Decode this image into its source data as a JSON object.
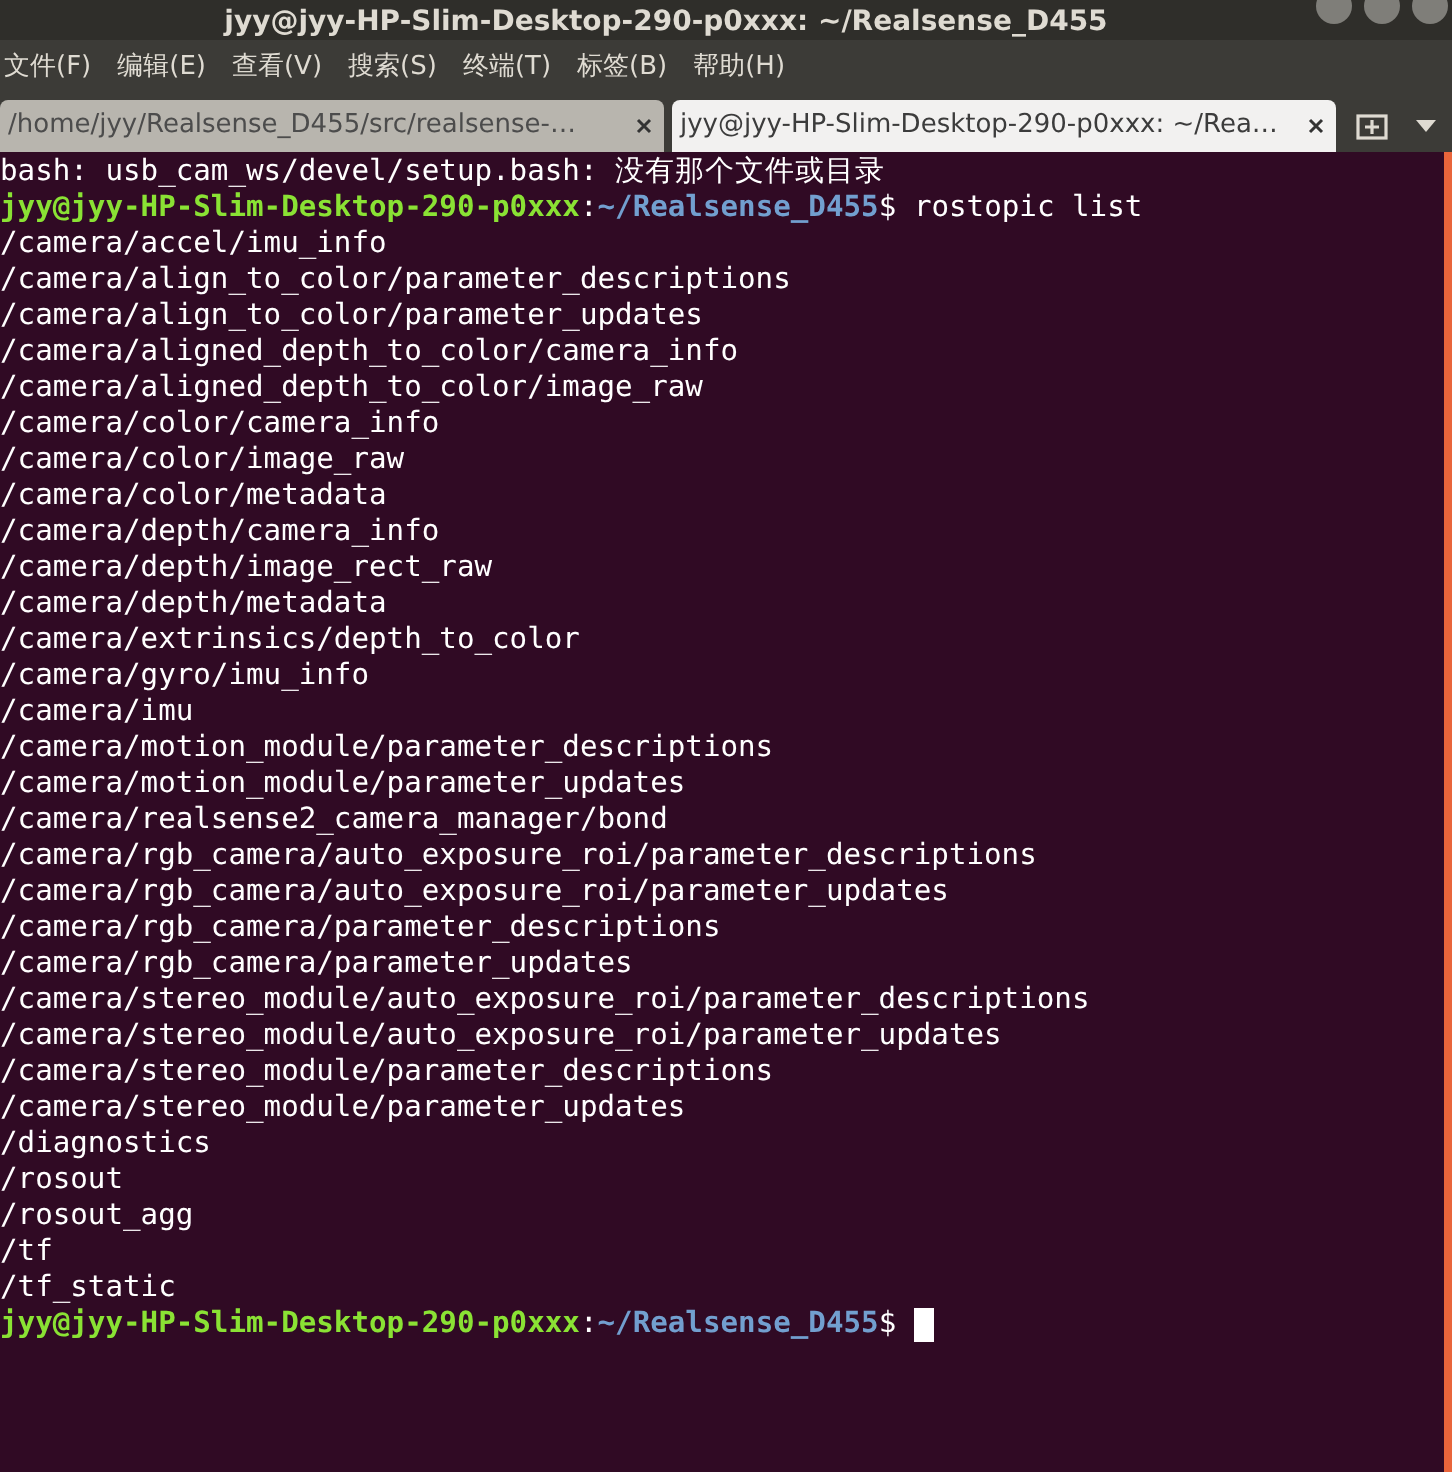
{
  "window": {
    "title": "jyy@jyy-HP-Slim-Desktop-290-p0xxx: ~/Realsense_D455"
  },
  "menu": [
    "文件(F)",
    "编辑(E)",
    "查看(V)",
    "搜索(S)",
    "终端(T)",
    "标签(B)",
    "帮助(H)"
  ],
  "tabs": [
    {
      "label": "/home/jyy/Realsense_D455/src/realsense-…",
      "selected": false
    },
    {
      "label": "jyy@jyy-HP-Slim-Desktop-290-p0xxx: ~/Rea…",
      "selected": true
    }
  ],
  "lines": [
    {
      "kind": "output",
      "text": "bash: usb_cam_ws/devel/setup.bash: 没有那个文件或目录"
    },
    {
      "kind": "prompt",
      "user": "jyy@jyy-HP-Slim-Desktop-290-p0xxx",
      "sep": ":",
      "path": "~/Realsense_D455",
      "sign": "$",
      "command": "rostopic list",
      "cursor": false
    },
    {
      "kind": "output",
      "text": "/camera/accel/imu_info"
    },
    {
      "kind": "output",
      "text": "/camera/align_to_color/parameter_descriptions"
    },
    {
      "kind": "output",
      "text": "/camera/align_to_color/parameter_updates"
    },
    {
      "kind": "output",
      "text": "/camera/aligned_depth_to_color/camera_info"
    },
    {
      "kind": "output",
      "text": "/camera/aligned_depth_to_color/image_raw"
    },
    {
      "kind": "output",
      "text": "/camera/color/camera_info"
    },
    {
      "kind": "output",
      "text": "/camera/color/image_raw"
    },
    {
      "kind": "output",
      "text": "/camera/color/metadata"
    },
    {
      "kind": "output",
      "text": "/camera/depth/camera_info"
    },
    {
      "kind": "output",
      "text": "/camera/depth/image_rect_raw"
    },
    {
      "kind": "output",
      "text": "/camera/depth/metadata"
    },
    {
      "kind": "output",
      "text": "/camera/extrinsics/depth_to_color"
    },
    {
      "kind": "output",
      "text": "/camera/gyro/imu_info"
    },
    {
      "kind": "output",
      "text": "/camera/imu"
    },
    {
      "kind": "output",
      "text": "/camera/motion_module/parameter_descriptions"
    },
    {
      "kind": "output",
      "text": "/camera/motion_module/parameter_updates"
    },
    {
      "kind": "output",
      "text": "/camera/realsense2_camera_manager/bond"
    },
    {
      "kind": "output",
      "text": "/camera/rgb_camera/auto_exposure_roi/parameter_descriptions"
    },
    {
      "kind": "output",
      "text": "/camera/rgb_camera/auto_exposure_roi/parameter_updates"
    },
    {
      "kind": "output",
      "text": "/camera/rgb_camera/parameter_descriptions"
    },
    {
      "kind": "output",
      "text": "/camera/rgb_camera/parameter_updates"
    },
    {
      "kind": "output",
      "text": "/camera/stereo_module/auto_exposure_roi/parameter_descriptions"
    },
    {
      "kind": "output",
      "text": "/camera/stereo_module/auto_exposure_roi/parameter_updates"
    },
    {
      "kind": "output",
      "text": "/camera/stereo_module/parameter_descriptions"
    },
    {
      "kind": "output",
      "text": "/camera/stereo_module/parameter_updates"
    },
    {
      "kind": "output",
      "text": "/diagnostics"
    },
    {
      "kind": "output",
      "text": "/rosout"
    },
    {
      "kind": "output",
      "text": "/rosout_agg"
    },
    {
      "kind": "output",
      "text": "/tf"
    },
    {
      "kind": "output",
      "text": "/tf_static"
    },
    {
      "kind": "prompt",
      "user": "jyy@jyy-HP-Slim-Desktop-290-p0xxx",
      "sep": ":",
      "path": "~/Realsense_D455",
      "sign": "$",
      "cursor": true
    }
  ]
}
